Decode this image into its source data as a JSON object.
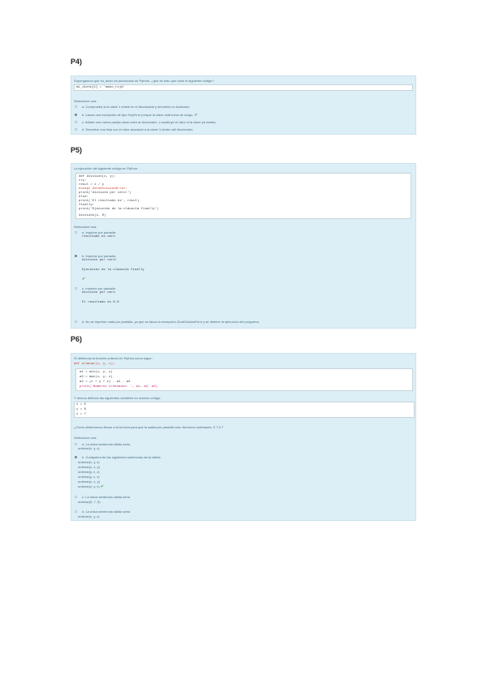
{
  "p4": {
    "heading": "P4)",
    "question": "Supongamos que mi_dicho es diccionario de Python, ¿qué es esto que hace el siguiente código?",
    "code": "mi_dicho[1] = 'mano_roja'",
    "select_label": "Seleccione una:",
    "options": [
      "a. Comprueba si la clave 1 existe en el diccionario y devuelve un booleano.",
      "b. Lanza una excepción de tipo KeyError porque la clave está fuera de rango.",
      "c. Añade una nueva pareja clave-valor al diccionario, o sustituye el valor si la clave ya existía.",
      "d. Devuelve una lista con el valor asociado a la clave 1 dentro del diccionario."
    ],
    "selected": 1,
    "checkmark": "✔"
  },
  "p5": {
    "heading": "P5)",
    "question": "La ejecución del siguiente código en Python:",
    "code_lines": [
      "def division(x, y):",
      "    try:",
      "        resul = x / y",
      "    except ZeroDivisionError:",
      "        print('división por cero!')",
      "    else:",
      "        print('El resultado es', resul)",
      "    finally:",
      "        print('Ejecución de la cláusula finally')",
      "",
      "division(1, 0)"
    ],
    "select_label": "Seleccione una:",
    "options": [
      {
        "lines": [
          "a. Imprime por pantalla:",
          "resultado es cero"
        ]
      },
      {
        "lines": [
          "b. Imprime por pantalla:",
          "división por cero!",
          "",
          "Ejecución de la cláusula finally"
        ]
      },
      {
        "lines": [
          "c. Imprime por pantalla:",
          "división por cero",
          "",
          "El resultado es 0.0"
        ]
      },
      {
        "lines": [
          "d. No se imprime nada por pantalla, ya que se lanza la excepción ZeroDivisionError y se detiene la ejecución del programa."
        ]
      }
    ],
    "selected": 1,
    "checkmark": "✔"
  },
  "p6": {
    "heading": "P6)",
    "question": "Si definimos la función ordenar en Python como sigue:",
    "code_def": "def ordenar(x, y, z):",
    "code_lines": [
      "a1 = min(x, y, z)",
      "a3 = max(x, y, z)",
      "a2 = (x + y + z) - a1 - a3",
      "print('Números ordenados: ', a1, a2, a3)"
    ],
    "vars_label": "Y hemos definido las siguientes variables en nuestro código:",
    "vars": [
      "x = 5",
      "y = 9",
      "z = 7"
    ],
    "prompt": "¿Cómo deberíamos llamar a la función para que la salida por pantalla sea: Números ordenados: 5 7 9 ?",
    "select_label": "Seleccione una:",
    "options": [
      {
        "lines": [
          "a. La única sentencia válida sería",
          "ordenar(x, y, z)"
        ]
      },
      {
        "lines": [
          "b. Cualquiera de las siguientes sentencias sería válida:",
          "ordenar(x, y, z)",
          "ordenar(x, z, y)",
          "ordenar(y, x, z)",
          "ordenar(y, z, x)",
          "ordenar(z, x, y)",
          "ordenar(z, y, x)"
        ]
      },
      {
        "lines": [
          "c. La única sentencia válida sería",
          "ordenar(5, 7, 9)"
        ]
      },
      {
        "lines": [
          "d. La única sentencia válida sería",
          "ordenar(x, y, z)"
        ]
      }
    ],
    "selected": 1,
    "checkmark": "✔"
  }
}
